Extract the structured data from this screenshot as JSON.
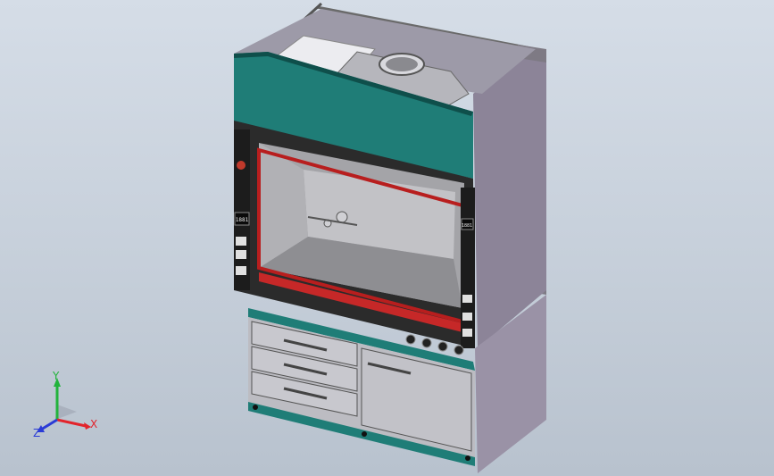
{
  "model": {
    "name": "fume-hood-assembly",
    "display": {
      "left": "1881",
      "right": "1881"
    }
  },
  "triad": {
    "x_label": "X",
    "y_label": "Y",
    "z_label": "Z"
  },
  "colors": {
    "background_top": "#d5dde7",
    "background_bottom": "#b8c2ce",
    "panel_teal": "#1f7d77",
    "frame_dark": "#2b2b2b",
    "sash_red": "#b81e1e",
    "cabinet_gray": "#bcbcc2",
    "side_purple": "#8c8498",
    "axis_x": "#e2242c",
    "axis_y": "#22b33c",
    "axis_z": "#2a3bd6"
  }
}
